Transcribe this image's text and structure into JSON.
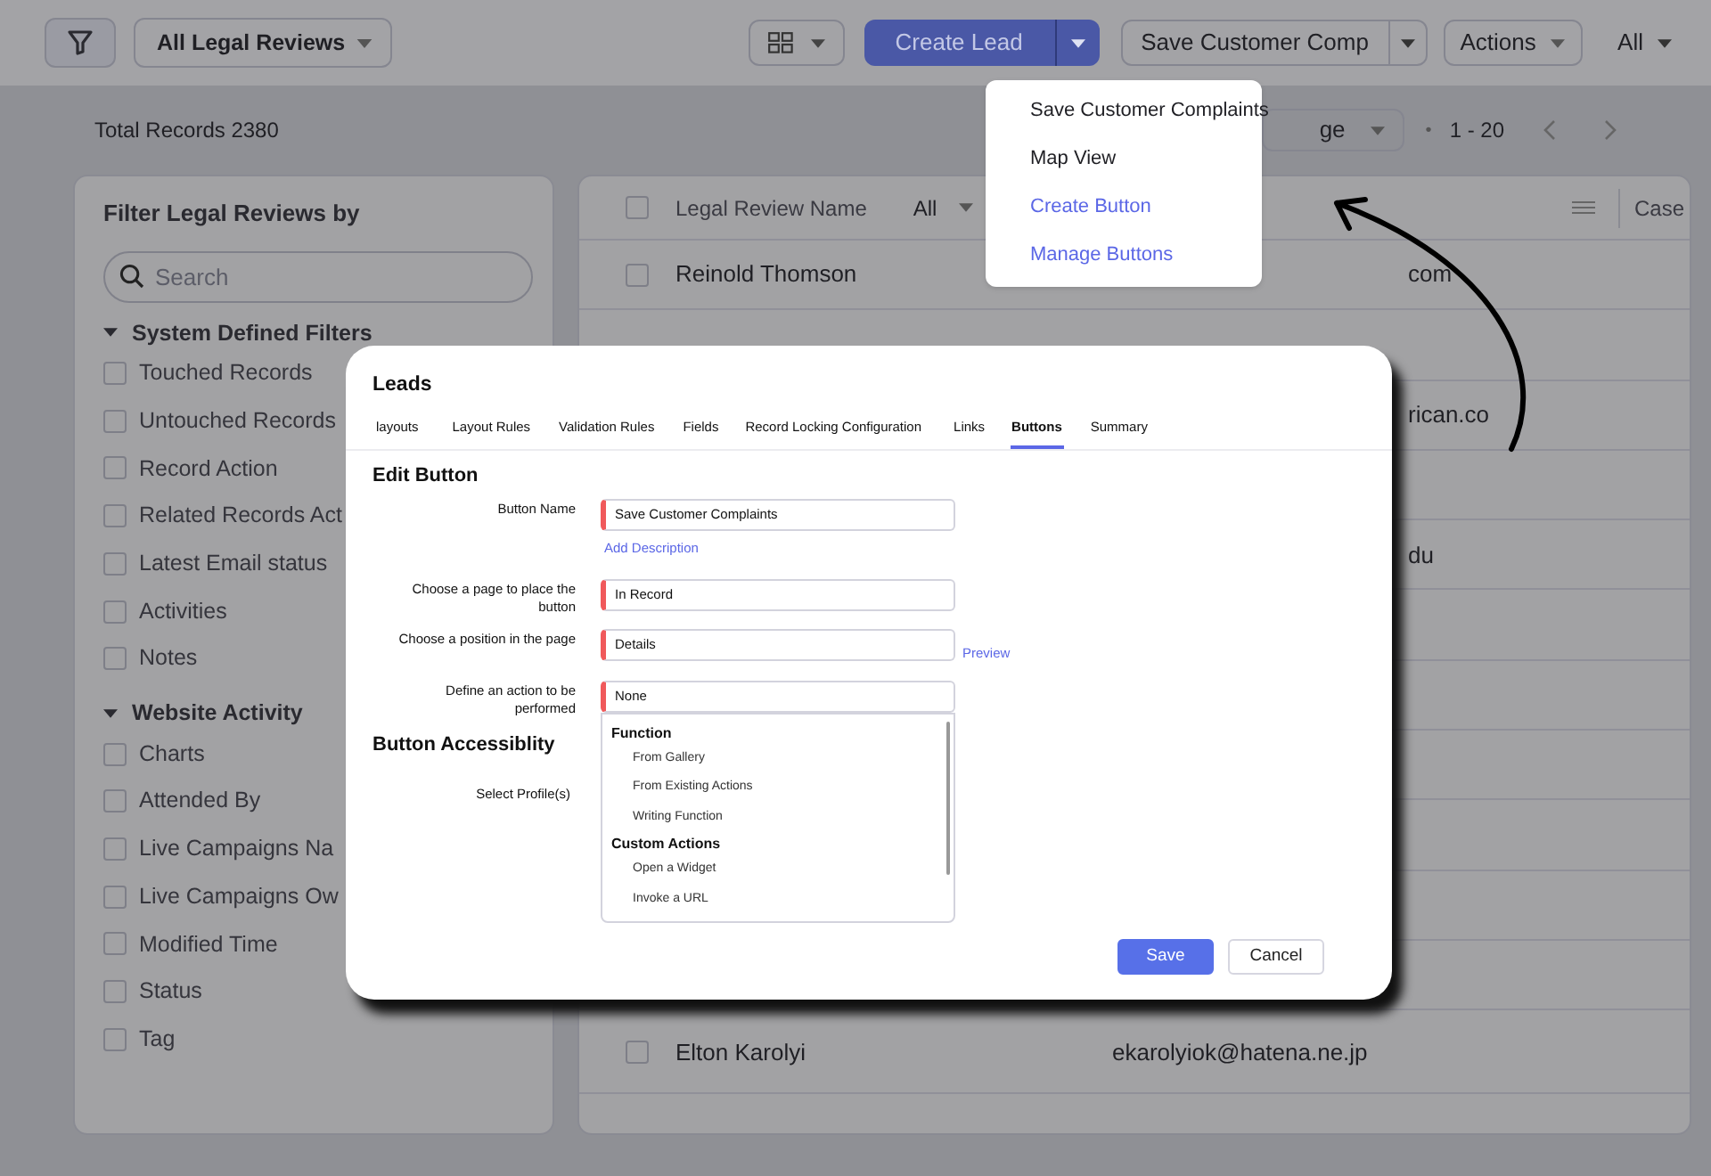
{
  "toolbar": {
    "view_selector": "All Legal Reviews",
    "create_button": "Create Lead",
    "custom_button": "Save Customer Comp",
    "actions_button": "Actions",
    "filter_all": "All"
  },
  "records_bar": {
    "total": "Total Records 2380",
    "per_page": "ge",
    "separator": "•",
    "range": "1 - 20"
  },
  "button_menu": [
    {
      "label": "Save Customer Complaints",
      "kind": "action"
    },
    {
      "label": "Map View",
      "kind": "action"
    },
    {
      "label": "Create Button",
      "kind": "config"
    },
    {
      "label": "Manage Buttons",
      "kind": "config"
    }
  ],
  "sidebar": {
    "title": "Filter Legal Reviews by",
    "search": {
      "placeholder": "Search"
    },
    "groups": [
      {
        "label": "System Defined Filters",
        "expanded": true,
        "items": [
          {
            "label": "Touched Records",
            "checked": false
          },
          {
            "label": "Untouched Records",
            "checked": false
          },
          {
            "label": "Record Action",
            "checked": false
          },
          {
            "label": "Related Records Act",
            "checked": false
          },
          {
            "label": "Latest Email status",
            "checked": false
          },
          {
            "label": "Activities",
            "checked": false
          },
          {
            "label": "Notes",
            "checked": false
          }
        ]
      },
      {
        "label": "Website Activity",
        "expanded": true,
        "items": [
          {
            "label": "Charts",
            "checked": false
          },
          {
            "label": "Attended By",
            "checked": false
          },
          {
            "label": "Live Campaigns Na",
            "checked": false
          },
          {
            "label": "Live Campaigns Ow",
            "checked": false
          },
          {
            "label": "Modified Time",
            "checked": false
          },
          {
            "label": "Status",
            "checked": false
          },
          {
            "label": "Tag",
            "checked": false
          }
        ]
      }
    ]
  },
  "table": {
    "header_checked": false,
    "columns": [
      {
        "label": "Legal Review Name",
        "filter": "All"
      },
      {
        "label": "Case"
      }
    ],
    "rows": [
      {
        "kind": "partial",
        "name": "Reinold Thomson",
        "email": "com",
        "checked": false
      },
      {
        "kind": "partial",
        "email": "rican.co"
      },
      {
        "kind": "partial",
        "email": "du"
      },
      {
        "kind": "full",
        "name": "Elton Karolyi",
        "email": "ekarolyiok@hatena.ne.jp",
        "checked": false
      }
    ]
  },
  "dialog": {
    "title": "Leads",
    "tabs": [
      {
        "label": "layouts",
        "selected": false
      },
      {
        "label": "Layout Rules",
        "selected": false
      },
      {
        "label": "Validation Rules",
        "selected": false
      },
      {
        "label": "Fields",
        "selected": false
      },
      {
        "label": "Record Locking Configuration",
        "selected": false
      },
      {
        "label": "Links",
        "selected": false
      },
      {
        "label": "Buttons",
        "selected": true
      },
      {
        "label": "Summary",
        "selected": false
      }
    ],
    "section_title": "Edit Button",
    "fields": [
      {
        "label": "Button Name",
        "value": "Save Customer Complaints",
        "link_below": "Add Description"
      },
      {
        "label": "Choose a page to place the button",
        "value": "In Record"
      },
      {
        "label": "Choose a position in the page",
        "value": "Details",
        "link_beside": "Preview"
      },
      {
        "label": "Define an action to be performed",
        "value": "None"
      }
    ],
    "action_options": [
      {
        "kind": "group",
        "label": "Function"
      },
      {
        "kind": "option",
        "label": "From Gallery"
      },
      {
        "kind": "option",
        "label": "From Existing Actions"
      },
      {
        "kind": "option",
        "label": "Writing Function"
      },
      {
        "kind": "group",
        "label": "Custom Actions"
      },
      {
        "kind": "option",
        "label": "Open a Widget"
      },
      {
        "kind": "option",
        "label": "Invoke a URL"
      }
    ],
    "accessibility_title": "Button Accessiblity",
    "profile_label": "Select Profile(s)",
    "buttons": [
      {
        "label": "Save",
        "kind": "primary"
      },
      {
        "label": "Cancel",
        "kind": "secondary"
      }
    ]
  }
}
